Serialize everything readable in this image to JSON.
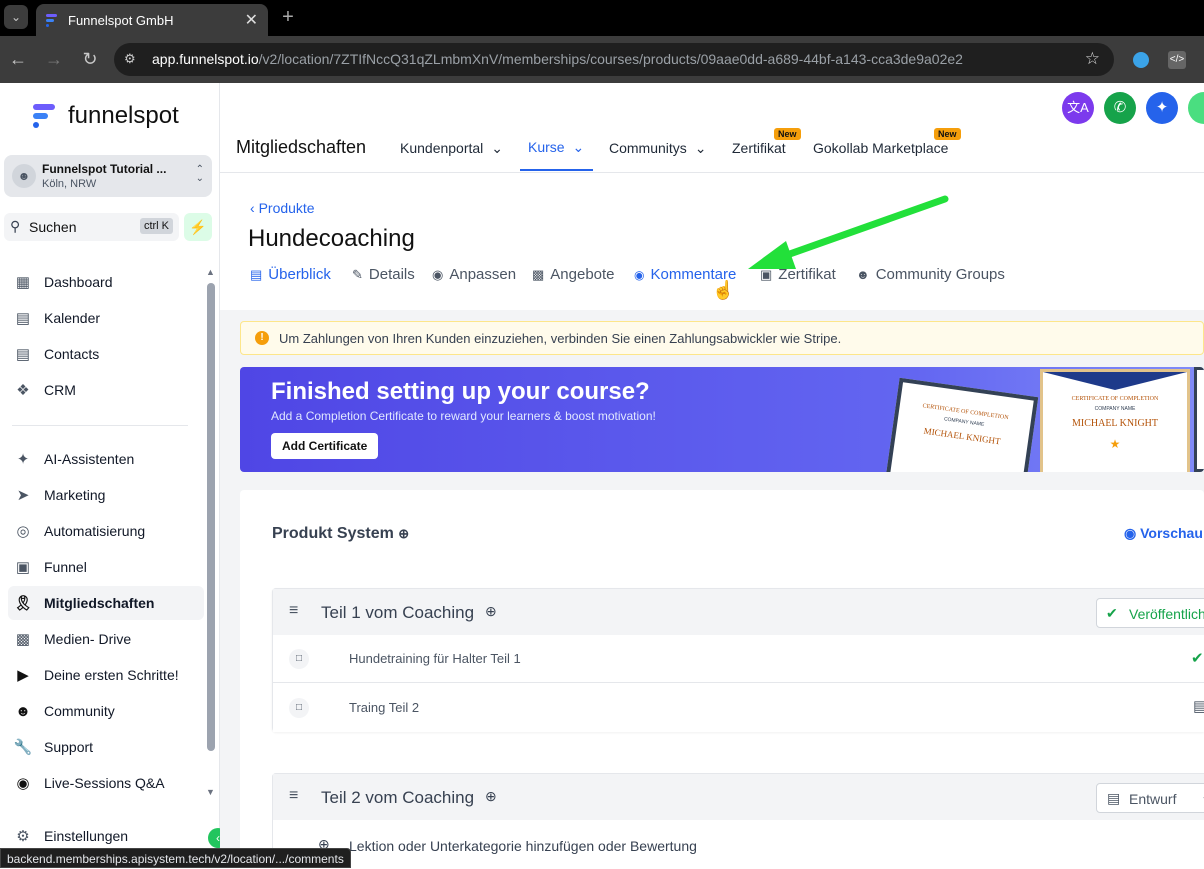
{
  "browser": {
    "tab_title": "Funnelspot GmbH",
    "url_host": "app.funnelspot.io",
    "url_path": "/v2/location/7ZTIfNccQ31qZLmbmXnV/memberships/courses/products/09aae0dd-a689-44bf-a143-cca3de9a02e2",
    "status_url": "backend.memberships.apisystem.tech/v2/location/.../comments"
  },
  "sidebar": {
    "brand": "funnelspot",
    "account_name": "Funnelspot Tutorial ...",
    "account_location": "Köln, NRW",
    "search_label": "Suchen",
    "search_shortcut": "ctrl K",
    "items": [
      {
        "label": "Dashboard",
        "icon": "grid-icon"
      },
      {
        "label": "Kalender",
        "icon": "calendar-icon"
      },
      {
        "label": "Contacts",
        "icon": "contacts-icon"
      },
      {
        "label": "CRM",
        "icon": "crm-icon"
      },
      {
        "label": "AI-Assistenten",
        "icon": "sparkle-icon"
      },
      {
        "label": "Marketing",
        "icon": "send-icon"
      },
      {
        "label": "Automatisierung",
        "icon": "automation-icon"
      },
      {
        "label": "Funnel",
        "icon": "funnel-icon"
      },
      {
        "label": "Mitgliedschaften",
        "icon": "award-icon"
      },
      {
        "label": "Medien- Drive",
        "icon": "image-icon"
      },
      {
        "label": "Deine ersten Schritte!",
        "icon": "play-icon"
      },
      {
        "label": "Community",
        "icon": "users-icon"
      },
      {
        "label": "Support",
        "icon": "wrench-icon"
      },
      {
        "label": "Live-Sessions Q&A",
        "icon": "chat-icon"
      },
      {
        "label": "Einstellungen",
        "icon": "gear-icon"
      }
    ]
  },
  "topnav": {
    "section_title": "Mitgliedschaften",
    "items": [
      {
        "label": "Kundenportal"
      },
      {
        "label": "Kurse"
      },
      {
        "label": "Communitys"
      },
      {
        "label": "Zertifikat",
        "badge": "New"
      },
      {
        "label": "Gokollab Marketplace",
        "badge": "New"
      }
    ]
  },
  "product": {
    "back_label": "Produkte",
    "title": "Hundecoaching",
    "tabs": [
      "Überblick",
      "Details",
      "Anpassen",
      "Angebote",
      "Kommentare",
      "Zertifikat",
      "Community Groups"
    ]
  },
  "alert": {
    "text": "Um Zahlungen von Ihren Kunden einzuziehen, verbinden Sie einen Zahlungsabwickler wie Stripe."
  },
  "banner": {
    "title": "Finished setting up your course?",
    "subtitle": "Add a Completion Certificate to reward your learners & boost motivation!",
    "button": "Add Certificate",
    "cert_heading": "CERTIFICATE OF COMPLETION",
    "cert_company": "COMPANY NAME",
    "cert_name": "MICHAEL KNIGHT"
  },
  "system": {
    "title": "Produkt System",
    "preview": "Vorschau",
    "categories": [
      {
        "title": "Teil 1 vom Coaching",
        "status": "Veröffentlicht",
        "lessons": [
          "Hundetraining für Halter Teil 1",
          "Traing Teil 2"
        ]
      },
      {
        "title": "Teil 2 vom Coaching",
        "status": "Entwurf",
        "add_label": "Lektion oder Unterkategorie hinzufügen oder Bewertung"
      }
    ]
  },
  "colors": {
    "accent": "#2563eb",
    "banner_bg": "#4f46e5",
    "success": "#16a34a",
    "alert_bg": "#fffbeb",
    "arrow": "#22e03a"
  }
}
